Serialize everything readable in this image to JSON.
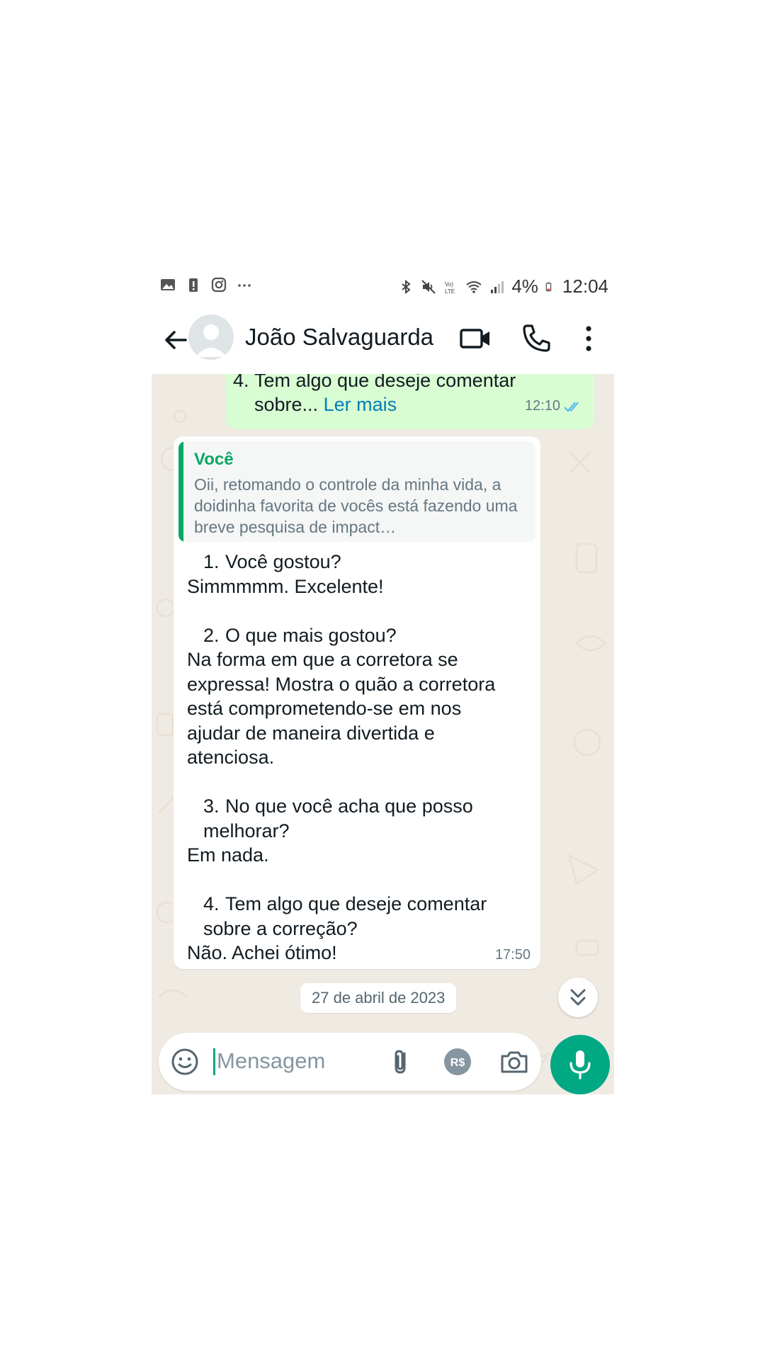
{
  "status_bar": {
    "battery": "4%",
    "time": "12:04",
    "left_icons": [
      "gallery-icon",
      "alert-battery-icon",
      "instagram-icon",
      "more-dots-icon"
    ],
    "right_icons": [
      "bluetooth-icon",
      "mute-icon",
      "volte-icon",
      "wifi-icon",
      "signal-icon",
      "battery-icon"
    ]
  },
  "header": {
    "contact_name": "João Salvaguarda",
    "icons": [
      "back-arrow-icon",
      "avatar",
      "video-call-icon",
      "phone-call-icon",
      "more-vertical-icon"
    ]
  },
  "chat": {
    "outgoing": {
      "number": "4.",
      "line1": "Tem algo que deseje comentar",
      "line2": "sobre...",
      "read_more": "Ler mais",
      "time": "12:10"
    },
    "incoming": {
      "quote_author": "Você",
      "quote_text": "Oii, retomando o controle da minha vida, a doidinha favorita de vocês está fazendo uma breve pesquisa de impact…",
      "q1_num": "1.",
      "q1": "Você gostou?",
      "a1": "Simmmmm. Excelente!",
      "q2_num": "2.",
      "q2": "O que mais gostou?",
      "a2_lines": [
        "Na forma em que a corretora se",
        "expressa! Mostra o quão a corretora",
        "está comprometendo-se em nos",
        "ajudar de maneira divertida e",
        "atenciosa."
      ],
      "q3_num": "3.",
      "q3_line1": "No que você acha que posso",
      "q3_line2": "melhorar?",
      "a3": "Em nada.",
      "q4_num": "4.",
      "q4_line1": "Tem algo que deseje comentar",
      "q4_line2": "sobre a correção?",
      "a4": "Não. Achei ótimo!",
      "time": "17:50"
    },
    "date_chip": "27 de abril de 2023"
  },
  "input_bar": {
    "placeholder": "Mensagem",
    "value": "",
    "icons": [
      "emoji-icon",
      "attach-icon",
      "payment-icon",
      "camera-icon",
      "mic-icon"
    ],
    "payment_label": "R$"
  },
  "colors": {
    "accent": "#00a884",
    "outgoing_bubble": "#d9fdd3",
    "chat_background": "#efeae2",
    "read_ticks": "#53bdeb",
    "quote_bar": "#06a764"
  }
}
